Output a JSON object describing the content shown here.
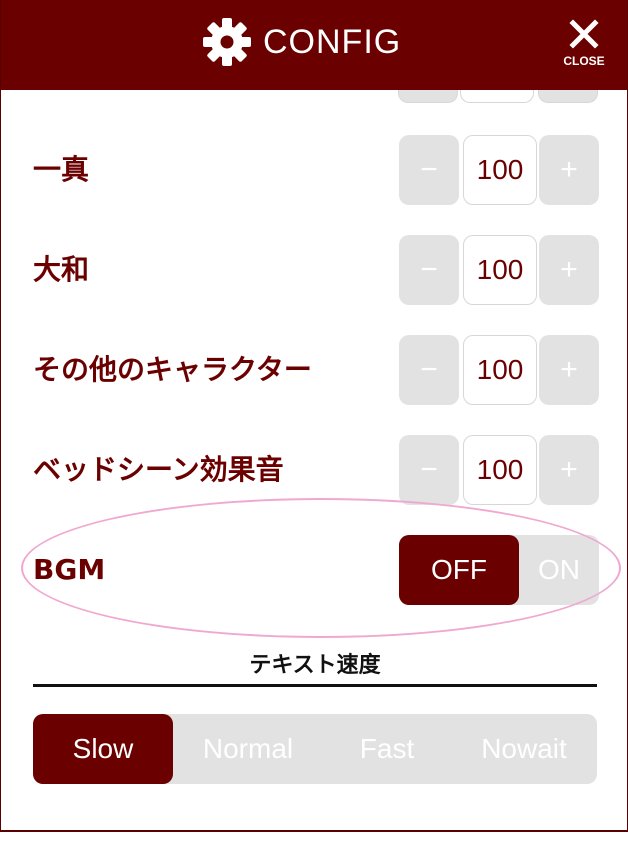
{
  "header": {
    "title": "CONFIG",
    "close_label": "CLOSE",
    "icon": "gear-icon",
    "close_icon": "close-icon"
  },
  "colors": {
    "accent": "#6b0000",
    "inactive": "#e2e2e2",
    "highlight_ring": "#f0a8d0"
  },
  "volume_rows": [
    {
      "label": "一真",
      "value": "100",
      "minus": "−",
      "plus": "+"
    },
    {
      "label": "大和",
      "value": "100",
      "minus": "−",
      "plus": "+"
    },
    {
      "label": "その他のキャラクター",
      "value": "100",
      "minus": "−",
      "plus": "+"
    },
    {
      "label": "ベッドシーン効果音",
      "value": "100",
      "minus": "−",
      "plus": "+"
    }
  ],
  "bgm": {
    "label": "BGM",
    "off_label": "OFF",
    "on_label": "ON",
    "selected": "OFF"
  },
  "text_speed": {
    "title": "テキスト速度",
    "options": [
      "Slow",
      "Normal",
      "Fast",
      "Nowait"
    ],
    "selected": "Slow"
  }
}
